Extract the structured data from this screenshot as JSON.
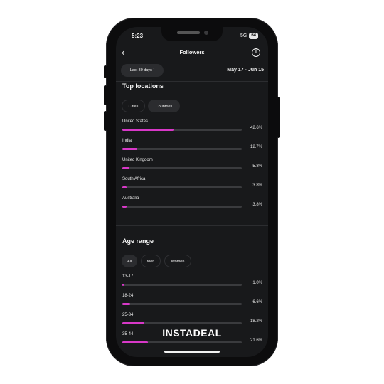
{
  "status": {
    "time": "5:23",
    "network": "5G",
    "battery": "64"
  },
  "header": {
    "title": "Followers",
    "back_icon": "chevron-left-icon",
    "info_icon": "info-icon"
  },
  "filter": {
    "period_label": "Last 30 days",
    "date_range": "May 17 - Jun 15"
  },
  "locations": {
    "title": "Top locations",
    "tabs": [
      {
        "label": "Cities",
        "active": false
      },
      {
        "label": "Countries",
        "active": true
      }
    ],
    "rows": [
      {
        "label": "United States",
        "value": "42.6%",
        "pct": 42.6
      },
      {
        "label": "India",
        "value": "12.7%",
        "pct": 12.7
      },
      {
        "label": "United Kingdom",
        "value": "5.8%",
        "pct": 5.8
      },
      {
        "label": "South Africa",
        "value": "3.8%",
        "pct": 3.8
      },
      {
        "label": "Australia",
        "value": "3.8%",
        "pct": 3.8
      }
    ]
  },
  "age": {
    "title": "Age range",
    "tabs": [
      {
        "label": "All",
        "active": true
      },
      {
        "label": "Men",
        "active": false
      },
      {
        "label": "Women",
        "active": false
      }
    ],
    "rows": [
      {
        "label": "13-17",
        "value": "1.0%",
        "pct": 1.0
      },
      {
        "label": "18-24",
        "value": "6.6%",
        "pct": 6.6
      },
      {
        "label": "25-34",
        "value": "18.2%",
        "pct": 18.2
      },
      {
        "label": "35-44",
        "value": "21.6%",
        "pct": 21.6
      }
    ]
  },
  "watermark": "INSTADEAL",
  "colors": {
    "accent": "#d838c8",
    "background": "#18191b"
  }
}
